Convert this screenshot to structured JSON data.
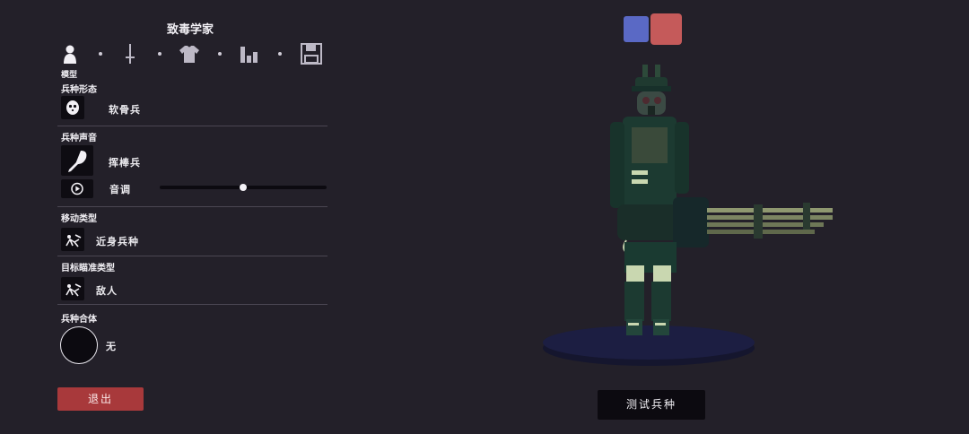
{
  "title": "致毒学家",
  "tabs": {
    "items": [
      {
        "icon": "person-icon"
      },
      {
        "icon": "sword-icon"
      },
      {
        "icon": "shirt-icon"
      },
      {
        "icon": "bar-chart-icon"
      },
      {
        "icon": "save-icon"
      }
    ],
    "active_label": "模型"
  },
  "form": {
    "label": "兵种形态",
    "value": "软骨兵",
    "icon": "ghost-face-icon"
  },
  "voice": {
    "label": "兵种声音",
    "value": "挥棒兵",
    "icon": "drumstick-icon",
    "pitch_label": "音调",
    "pitch_value": 0.5
  },
  "movement": {
    "label": "移动类型",
    "value": "近身兵种",
    "icon": "melee-figure-icon"
  },
  "targeting": {
    "label": "目标瞄准类型",
    "value": "敌人",
    "icon": "target-figure-icon"
  },
  "fusion": {
    "label": "兵种合体",
    "value": "无"
  },
  "buttons": {
    "exit": "退出",
    "test": "测试兵种"
  },
  "team_colors": {
    "blue": "#5a69c5",
    "red": "#c55a5a"
  }
}
